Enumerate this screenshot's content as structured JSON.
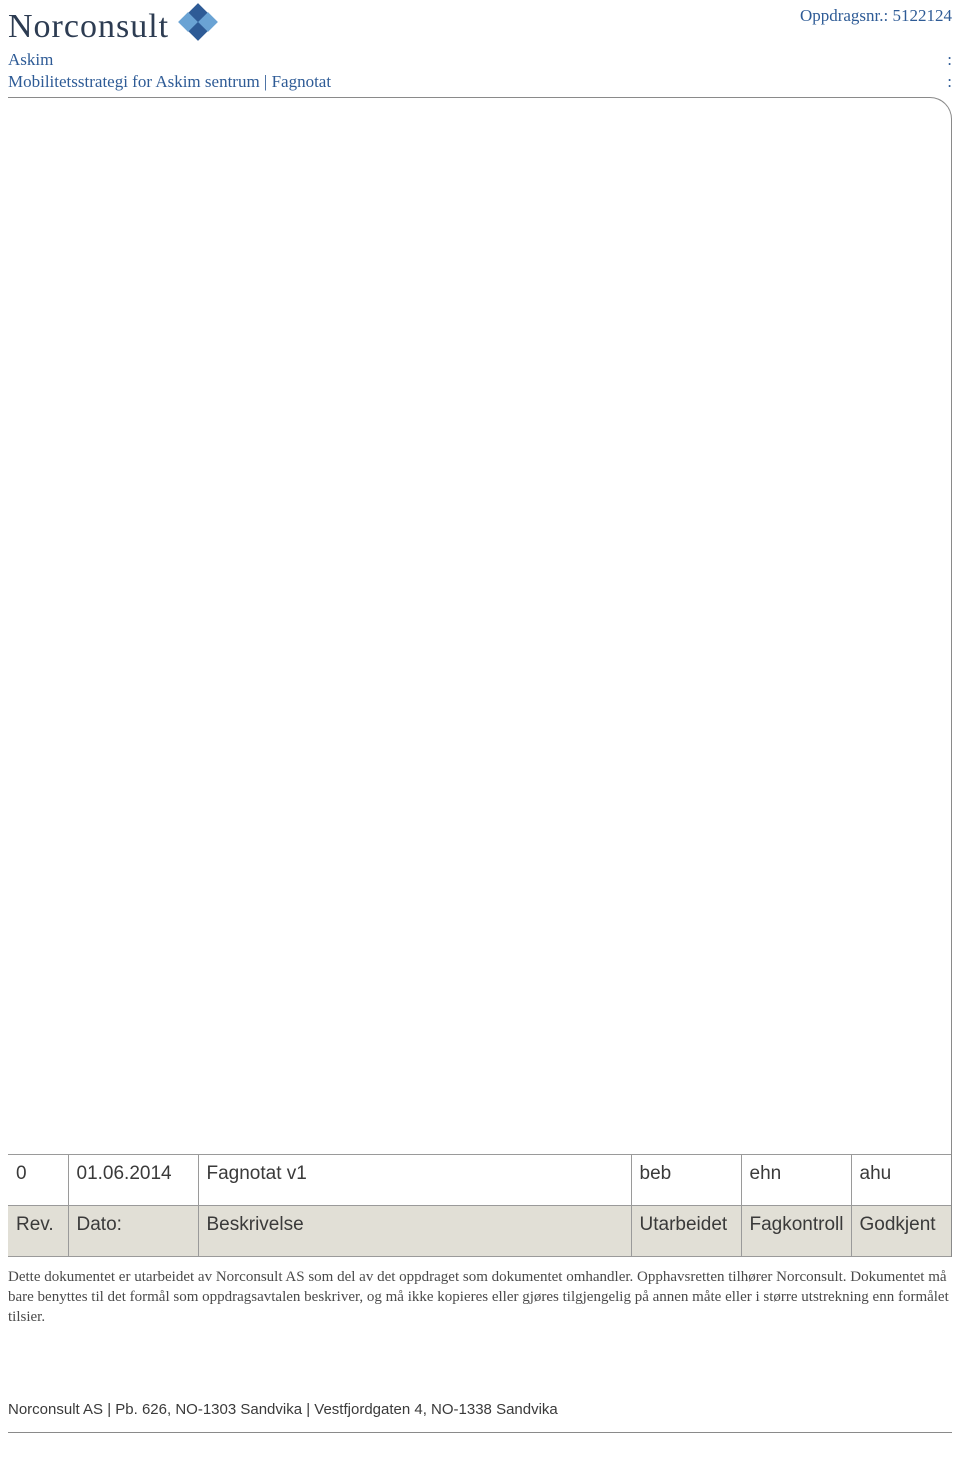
{
  "header": {
    "company_name": "Norconsult",
    "oppdrags_label": "Oppdragsnr.:",
    "oppdrags_nr": "5122124",
    "client": "Askim",
    "doc_title": "Mobilitetsstrategi for Askim sentrum | Fagnotat",
    "colon": ":"
  },
  "revision_table": {
    "data": {
      "rev": "0",
      "date": "01.06.2014",
      "desc": "Fagnotat v1",
      "by": "beb",
      "check": "ehn",
      "appr": "ahu"
    },
    "headers": {
      "rev": "Rev.",
      "date": "Dato:",
      "desc": "Beskrivelse",
      "by": "Utarbeidet",
      "check": "Fagkontroll",
      "appr": "Godkjent"
    }
  },
  "disclaimer": "Dette dokumentet er utarbeidet av Norconsult AS som del av det oppdraget som dokumentet omhandler. Opphavsretten tilhører Norconsult. Dokumentet må bare benyttes til det formål som oppdragsavtalen beskriver, og må ikke kopieres eller gjøres tilgjengelig på annen måte eller i større utstrekning enn formålet tilsier.",
  "footer": {
    "text": "Norconsult AS | Pb. 626, NO-1303 Sandvika | Vestfjordgaten 4, NO-1338 Sandvika"
  }
}
